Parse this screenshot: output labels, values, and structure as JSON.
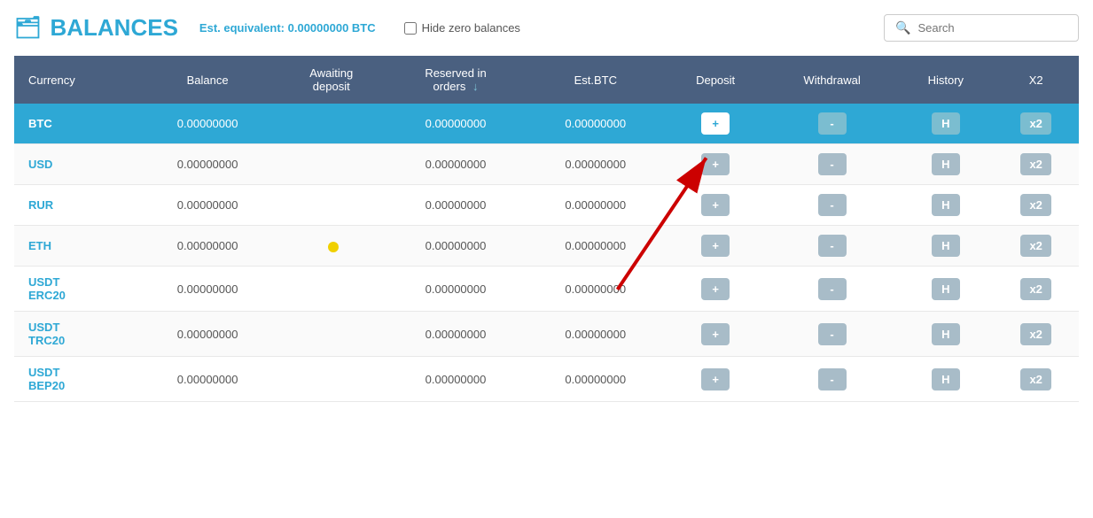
{
  "header": {
    "title": "BALANCES",
    "wallet_icon": "🗂",
    "est_label": "Est. equivalent:",
    "est_value": "0.00000000 BTC",
    "hide_zero_label": "Hide zero balances",
    "search_placeholder": "Search"
  },
  "table": {
    "columns": [
      {
        "label": "Currency",
        "key": "currency"
      },
      {
        "label": "Balance",
        "key": "balance"
      },
      {
        "label": "Awaiting deposit",
        "key": "awaiting"
      },
      {
        "label": "Reserved in orders",
        "key": "reserved",
        "sortable": true
      },
      {
        "label": "Est.BTC",
        "key": "estbtc"
      },
      {
        "label": "Deposit",
        "key": "deposit"
      },
      {
        "label": "Withdrawal",
        "key": "withdrawal"
      },
      {
        "label": "History",
        "key": "history"
      },
      {
        "label": "X2",
        "key": "x2"
      }
    ],
    "rows": [
      {
        "currency": "BTC",
        "balance": "0.00000000",
        "awaiting": "",
        "reserved": "0.00000000",
        "estbtc": "0.00000000",
        "active": true
      },
      {
        "currency": "USD",
        "balance": "0.00000000",
        "awaiting": "",
        "reserved": "0.00000000",
        "estbtc": "0.00000000",
        "active": false
      },
      {
        "currency": "RUR",
        "balance": "0.00000000",
        "awaiting": "",
        "reserved": "0.00000000",
        "estbtc": "0.00000000",
        "active": false
      },
      {
        "currency": "ETH",
        "balance": "0.00000000",
        "awaiting": "",
        "reserved": "0.00000000",
        "estbtc": "0.00000000",
        "active": false,
        "eth_dot": true
      },
      {
        "currency": "USDT\nERC20",
        "balance": "0.00000000",
        "awaiting": "",
        "reserved": "0.00000000",
        "estbtc": "0.00000000",
        "active": false
      },
      {
        "currency": "USDT\nTRC20",
        "balance": "0.00000000",
        "awaiting": "",
        "reserved": "0.00000000",
        "estbtc": "0.00000000",
        "active": false
      },
      {
        "currency": "USDT\nBEP20",
        "balance": "0.00000000",
        "awaiting": "",
        "reserved": "0.00000000",
        "estbtc": "0.00000000",
        "active": false
      }
    ],
    "btn_deposit": "+",
    "btn_withdraw": "-",
    "btn_history": "H",
    "btn_x2": "x2"
  }
}
